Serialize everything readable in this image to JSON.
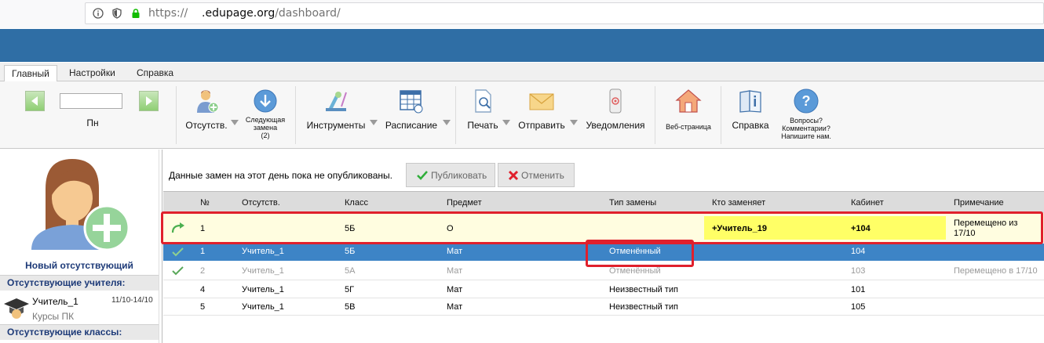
{
  "browser": {
    "url_scheme": "https://",
    "url_host": ".edupage.org",
    "url_path": "/dashboard/"
  },
  "tabs": [
    "Главный",
    "Настройки",
    "Справка"
  ],
  "ribbon": {
    "day_label": "Пн",
    "date_value": "",
    "absences": "Отсутств.",
    "next_sub_line1": "Следующая",
    "next_sub_line2": "замена",
    "next_sub_line3": "(2)",
    "tools": "Инструменты",
    "timetable": "Расписание",
    "print": "Печать",
    "send": "Отправить",
    "notifications": "Уведомления",
    "web_page": "Веб-страница",
    "help": "Справка",
    "questions_line1": "Вопросы?",
    "questions_line2": "Комментарии?",
    "questions_line3": "Напишите нам."
  },
  "left": {
    "new_absent": "Новый отсутствующий",
    "absent_teachers_head": "Отсутствующие учителя:",
    "absent_teacher_name": "Учитель_1",
    "absent_teacher_reason": "Курсы ПК",
    "absent_teacher_dates": "11/10-14/10",
    "absent_classes_head": "Отсутствующие классы:"
  },
  "main": {
    "notice": "Данные замен на этот день пока не опубликованы.",
    "publish": "Публиковать",
    "cancel": "Отменить"
  },
  "table": {
    "headers": {
      "num": "№",
      "absent": "Отсутств.",
      "class": "Класс",
      "subject": "Предмет",
      "type": "Тип замены",
      "who": "Кто заменяет",
      "room": "Кабинет",
      "note": "Примечание"
    },
    "rows": [
      {
        "num": "1",
        "absent": "",
        "class": "5Б",
        "subject": "О",
        "type": "",
        "who": "+Учитель_19",
        "room": "+104",
        "note1": "Перемещено из",
        "note2": "17/10"
      },
      {
        "num": "1",
        "absent": "Учитель_1",
        "class": "5Б",
        "subject": "Мат",
        "type": "Отменённый",
        "who": "",
        "room": "104",
        "note1": ""
      },
      {
        "num": "2",
        "absent": "Учитель_1",
        "class": "5А",
        "subject": "Мат",
        "type": "Отменённый",
        "who": "",
        "room": "103",
        "note1": "Перемещено в 17/10"
      },
      {
        "num": "4",
        "absent": "Учитель_1",
        "class": "5Г",
        "subject": "Мат",
        "type": "Неизвестный тип",
        "who": "",
        "room": "101",
        "note1": ""
      },
      {
        "num": "5",
        "absent": "Учитель_1",
        "class": "5В",
        "subject": "Мат",
        "type": "Неизвестный тип",
        "who": "",
        "room": "105",
        "note1": ""
      }
    ]
  },
  "colors": {
    "header_blue": "#2f6ea5",
    "selected_row": "#3d84c6",
    "moved_row": "#fffde0",
    "highlight_yellow": "#ffff66",
    "annotation_red": "#e0202c"
  }
}
